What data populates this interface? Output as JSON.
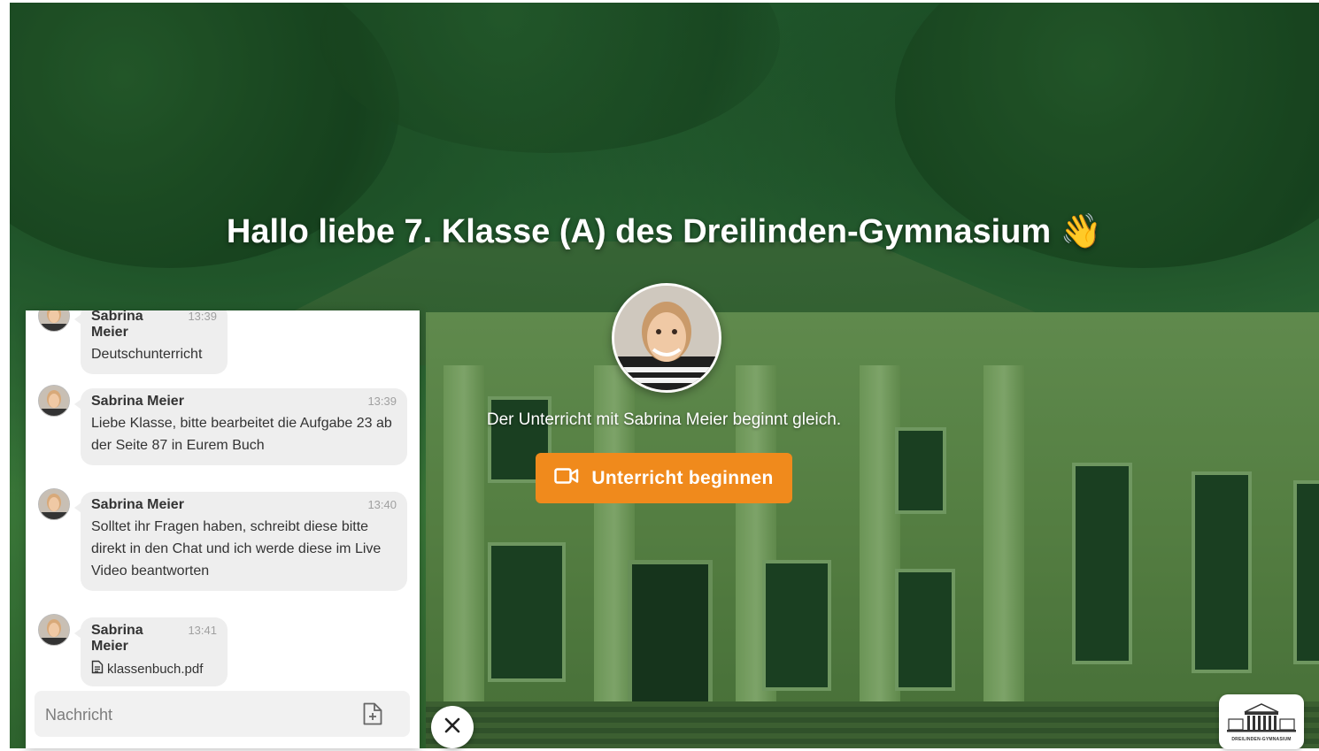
{
  "hero": {
    "title": "Hallo liebe 7. Klasse (A) des Dreilinden-Gymnasium",
    "title_emoji": "👋",
    "status_text": "Der Unterricht mit Sabrina Meier beginnt gleich.",
    "start_button_label": "Unterricht beginnen"
  },
  "chat": {
    "messages": [
      {
        "author": "Sabrina Meier",
        "time": "13:39",
        "text": "Deutschunterricht"
      },
      {
        "author": "Sabrina Meier",
        "time": "13:39",
        "text": "Liebe Klasse, bitte bearbeitet die Aufgabe 23 ab der Seite 87 in Eurem Buch"
      },
      {
        "author": "Sabrina Meier",
        "time": "13:40",
        "text": "Solltet ihr Fragen haben, schreibt diese bitte direkt in den Chat und ich werde diese im Live Video beantworten"
      },
      {
        "author": "Sabrina Meier",
        "time": "13:41",
        "file": "klassenbuch.pdf"
      }
    ],
    "input_placeholder": "Nachricht"
  },
  "logo": {
    "text": "DREILINDEN-GYMNASIUM"
  },
  "colors": {
    "accent": "#f08a1c",
    "scene_tint": "#2e6a3a"
  },
  "icons": {
    "start": "video-camera-icon",
    "attach": "file-add-icon",
    "close": "close-icon",
    "file": "document-icon"
  }
}
